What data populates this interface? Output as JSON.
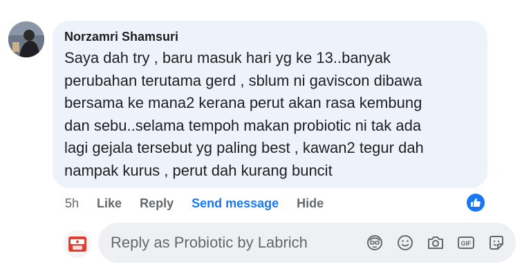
{
  "comment": {
    "author": "Norzamri Shamsuri",
    "text": "Saya dah try , baru masuk hari yg ke 13..banyak\nperubahan terutama gerd , sblum ni gaviscon dibawa\nbersama ke mana2 kerana perut akan rasa kembung\ndan sebu..selama tempoh makan probiotic ni tak ada\nlagi gejala tersebut yg paling best , kawan2 tegur dah\nnampak kurus , perut dah kurang buncit"
  },
  "actions": {
    "time": "5h",
    "like": "Like",
    "reply": "Reply",
    "send_message": "Send message",
    "hide": "Hide"
  },
  "reply_box": {
    "placeholder": "Reply as Probiotic by Labrich",
    "icons": [
      "avatar-sticker-icon",
      "emoji-icon",
      "camera-icon",
      "gif-icon",
      "sticker-icon"
    ]
  },
  "colors": {
    "bubble": "#eef3fb",
    "accent": "#1877f2",
    "muted": "#65676b",
    "input_bg": "#eef0f3"
  }
}
